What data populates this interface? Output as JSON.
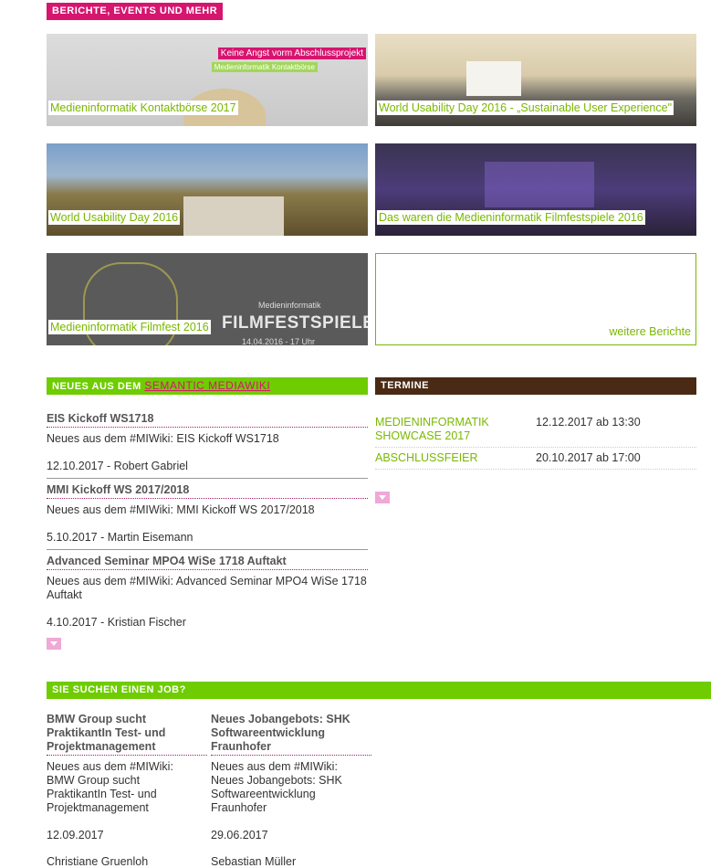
{
  "sections": {
    "reports": "BERICHTE, EVENTS UND MEHR",
    "news_prefix": "NEUES AUS DEM",
    "news_link": "SEMANTIC MEDIAWIKI",
    "dates": "TERMINE",
    "jobs": "SIE SUCHEN EINEN JOB?"
  },
  "tiles": [
    {
      "caption": "Medieninformatik Kontaktbörse 2017",
      "overlay1": "Keine Angst vorm Abschlussprojekt",
      "overlay2": "Medieninformatik Kontaktbörse"
    },
    {
      "caption": "World Usability Day 2016 - „Sustainable User Experience\""
    },
    {
      "caption": "World Usability Day 2016"
    },
    {
      "caption": "Das waren die Medieninformatik Filmfestspiele 2016"
    },
    {
      "caption": "Medieninformatik Filmfest 2016",
      "poster_small": "Medieninformatik",
      "poster_big": "FILMFESTSPIELE",
      "poster_date": "14.04.2016 - 17 Uhr"
    }
  ],
  "more_reports": "weitere Berichte",
  "news": [
    {
      "title": "EIS Kickoff WS1718",
      "body": "Neues aus dem #MIWiki: EIS Kickoff WS1718",
      "meta": "12.10.2017 - Robert Gabriel"
    },
    {
      "title": "MMI Kickoff WS 2017/2018",
      "body": "Neues aus dem #MIWiki: MMI Kickoff WS 2017/2018",
      "meta": "5.10.2017 - Martin Eisemann"
    },
    {
      "title": "Advanced Seminar MPO4 WiSe 1718 Auftakt",
      "body": "Neues aus dem #MIWiki: Advanced Seminar MPO4 WiSe 1718 Auftakt",
      "meta": "4.10.2017 - Kristian Fischer"
    }
  ],
  "events": [
    {
      "name": "Medieninformatik Showcase 2017",
      "date": "12.12.2017 ab 13:30"
    },
    {
      "name": "Abschlussfeier",
      "date": "20.10.2017 ab 17:00"
    }
  ],
  "jobs": [
    {
      "title": "BMW Group sucht PraktikantIn Test- und Projektmanagement",
      "body": "Neues aus dem #MIWiki: BMW Group sucht PraktikantIn Test- und Projektmanagement",
      "date": "12.09.2017",
      "author": "Christiane Gruenloh"
    },
    {
      "title": "Neues Jobangebots: SHK Softwareentwicklung Fraunhofer",
      "body": "Neues aus dem #MIWiki: Neues Jobangebots: SHK Softwareentwicklung Fraunhofer",
      "date": "29.06.2017",
      "author": "Sebastian Müller"
    }
  ],
  "colors": {
    "pink": "#d6156f",
    "green": "#6ecc00",
    "brown": "#4a2a14",
    "link_green": "#7ab800"
  }
}
